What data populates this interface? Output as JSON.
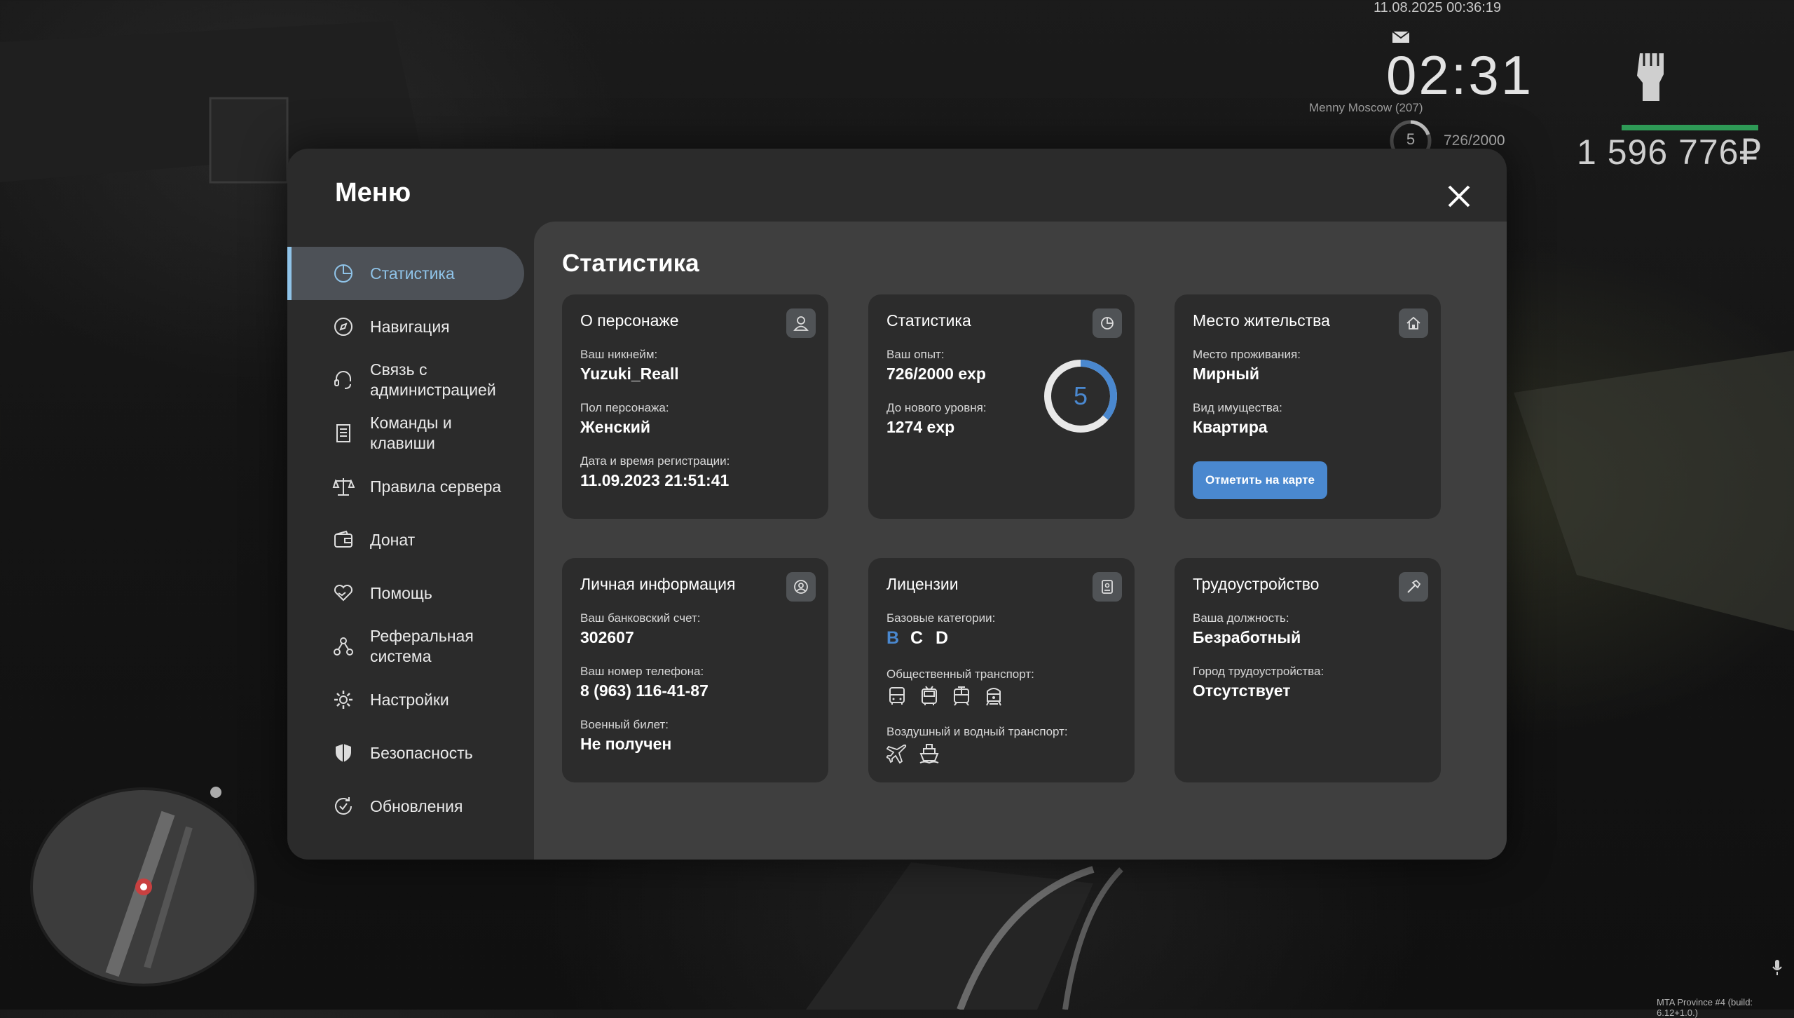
{
  "hud": {
    "datetime": "11.08.2025 00:36:19",
    "time": "02:31",
    "location": "Menny Moscow (207)",
    "level": "5",
    "exp": "726/2000",
    "money": "1 596 776₽",
    "build": "MTA Province #4 (build: 6.12+1.0.)"
  },
  "menu": {
    "title": "Меню",
    "nav": [
      {
        "label": "Статистика",
        "icon": "pie-chart-icon"
      },
      {
        "label": "Навигация",
        "icon": "compass-icon"
      },
      {
        "label": "Связь с администрацией",
        "icon": "headset-icon"
      },
      {
        "label": "Команды и клавиши",
        "icon": "document-icon"
      },
      {
        "label": "Правила сервера",
        "icon": "scales-icon"
      },
      {
        "label": "Донат",
        "icon": "wallet-icon"
      },
      {
        "label": "Помощь",
        "icon": "handshake-heart-icon"
      },
      {
        "label": "Реферальная система",
        "icon": "referral-icon"
      },
      {
        "label": "Настройки",
        "icon": "gear-icon"
      },
      {
        "label": "Безопасность",
        "icon": "shield-icon"
      },
      {
        "label": "Обновления",
        "icon": "update-icon"
      }
    ]
  },
  "content": {
    "title": "Статистика",
    "character": {
      "title": "О персонаже",
      "nick_label": "Ваш никнейм:",
      "nick": "Yuzuki_Reall",
      "gender_label": "Пол персонажа:",
      "gender": "Женский",
      "reg_label": "Дата и время регистрации:",
      "reg": "11.09.2023 21:51:41"
    },
    "stats": {
      "title": "Статистика",
      "exp_label": "Ваш опыт:",
      "exp": "726/2000 exp",
      "next_label": "До нового уровня:",
      "next": "1274 exp",
      "level": "5",
      "progress": 0.363
    },
    "residence": {
      "title": "Место жительства",
      "place_label": "Место проживания:",
      "place": "Мирный",
      "type_label": "Вид имущества:",
      "type": "Квартира",
      "button": "Отметить на карте"
    },
    "personal": {
      "title": "Личная информация",
      "bank_label": "Ваш банковский счет:",
      "bank": "302607",
      "phone_label": "Ваш номер телефона:",
      "phone": "8 (963) 116-41-87",
      "military_label": "Военный билет:",
      "military": "Не получен"
    },
    "licenses": {
      "title": "Лицензии",
      "base_label": "Базовые категории:",
      "categories": [
        "B",
        "C",
        "D"
      ],
      "category_colors": [
        "#4a88cf",
        "#ffffff",
        "#ffffff"
      ],
      "public_label": "Общественный транспорт:",
      "public_icons": [
        "bus-icon",
        "trolleybus-icon",
        "tram-icon",
        "train-icon"
      ],
      "air_label": "Воздушный и водный транспорт:",
      "air_icons": [
        "plane-icon",
        "ship-icon"
      ]
    },
    "job": {
      "title": "Трудоустройство",
      "position_label": "Ваша должность:",
      "position": "Безработный",
      "city_label": "Город трудоустройства:",
      "city": "Отсутствует"
    }
  }
}
